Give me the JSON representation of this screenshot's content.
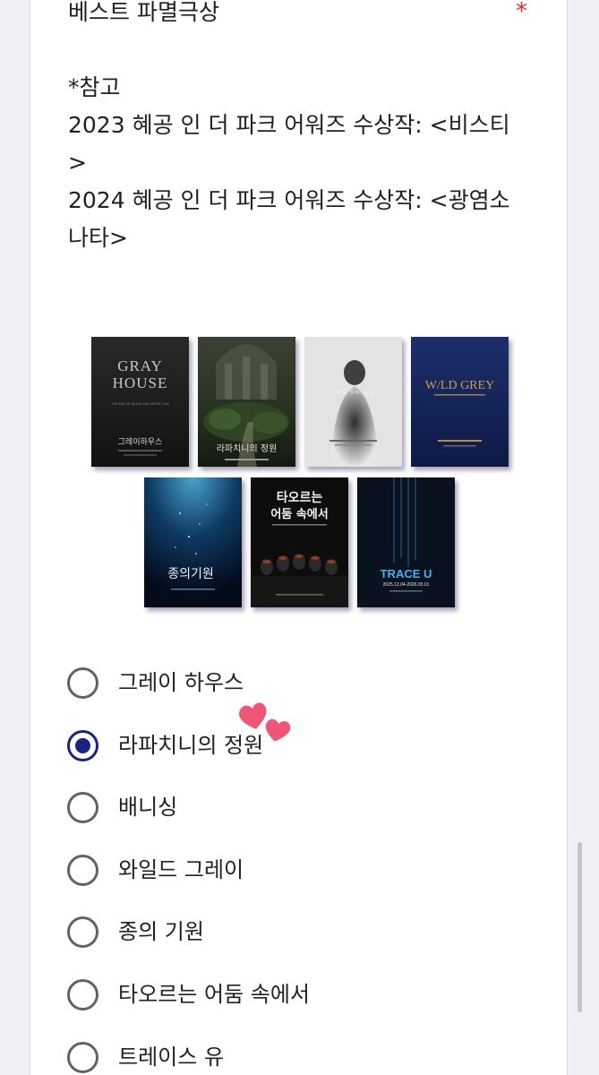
{
  "question": {
    "title": "베스트 파멸극상",
    "required_mark": "*",
    "description_lines": [
      "*참고",
      "2023 혜공 인 더 파크 어워즈 수상작: <비스티",
      ">",
      "2024 혜공 인 더 파크 어워즈 수상작: <광염소",
      "나타>"
    ]
  },
  "posters": [
    {
      "name": "poster-gray-house",
      "title_line1": "GRAY",
      "title_line2": "HOUSE",
      "subtitle": "THE AGE OF BLACK AND WHITE FILM",
      "ko_title": "그레이하우스"
    },
    {
      "name": "poster-rappaccini",
      "ko_title": "라파치니의 정원"
    },
    {
      "name": "poster-vanishing",
      "title": "VANISHING"
    },
    {
      "name": "poster-wild-grey",
      "title": "W/LD GREY"
    },
    {
      "name": "poster-origin-of-species",
      "ko_title": "종의기원"
    },
    {
      "name": "poster-burning-darkness",
      "ko_line1": "타오르는",
      "ko_line2": "어둠 속에서"
    },
    {
      "name": "poster-trace-u",
      "title": "TRACE U",
      "dates": "2025.12.04-2026.03.01"
    }
  ],
  "options": [
    {
      "label": "그레이 하우스",
      "selected": false
    },
    {
      "label": "라파치니의 정원",
      "selected": true
    },
    {
      "label": "배니싱",
      "selected": false
    },
    {
      "label": "와일드 그레이",
      "selected": false
    },
    {
      "label": "종의 기원",
      "selected": false
    },
    {
      "label": "타오르는 어둠 속에서",
      "selected": false
    },
    {
      "label": "트레이스 유",
      "selected": false
    }
  ],
  "colors": {
    "accent": "#1a237e",
    "required": "#d93025",
    "heart": "#ef5577"
  }
}
